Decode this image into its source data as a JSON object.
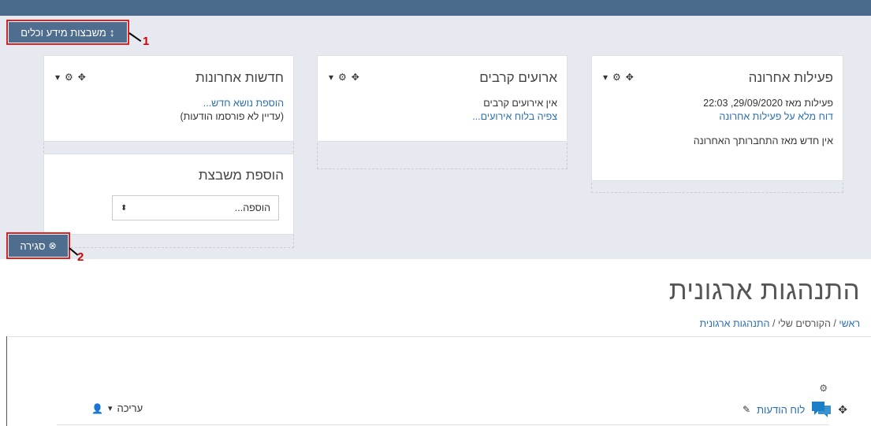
{
  "drawer": {
    "toggle_label": "משבצות מידע וכלים",
    "close_label": "סגירה"
  },
  "annotations": [
    "1",
    "2"
  ],
  "blocks": {
    "recent_activity": {
      "title": "פעילות אחרונה",
      "since": "פעילות מאז 29/09/2020, 22:03",
      "full_report": "דוח מלא על פעילות אחרונה",
      "nothing_new": "אין חדש מאז התחברותך האחרונה"
    },
    "upcoming_events": {
      "title": "ארועים קרבים",
      "none": "אין אירועים קרבים",
      "go_calendar": "צפיה בלוח אירועים..."
    },
    "latest_news": {
      "title": "חדשות אחרונות",
      "add_topic": "הוספת נושא חדש...",
      "none_yet": "(עדיין לא פורסמו הודעות)"
    },
    "add_block": {
      "title": "הוספת משבצת",
      "select_value": "הוספה..."
    }
  },
  "page": {
    "title": "התנהגות ארגונית",
    "breadcrumb": [
      "ראשי",
      "הקורסים שלי",
      "התנהגות ארגונית"
    ]
  },
  "section": {
    "forum_label": "לוח הודעות",
    "edit_label": "עריכה"
  }
}
